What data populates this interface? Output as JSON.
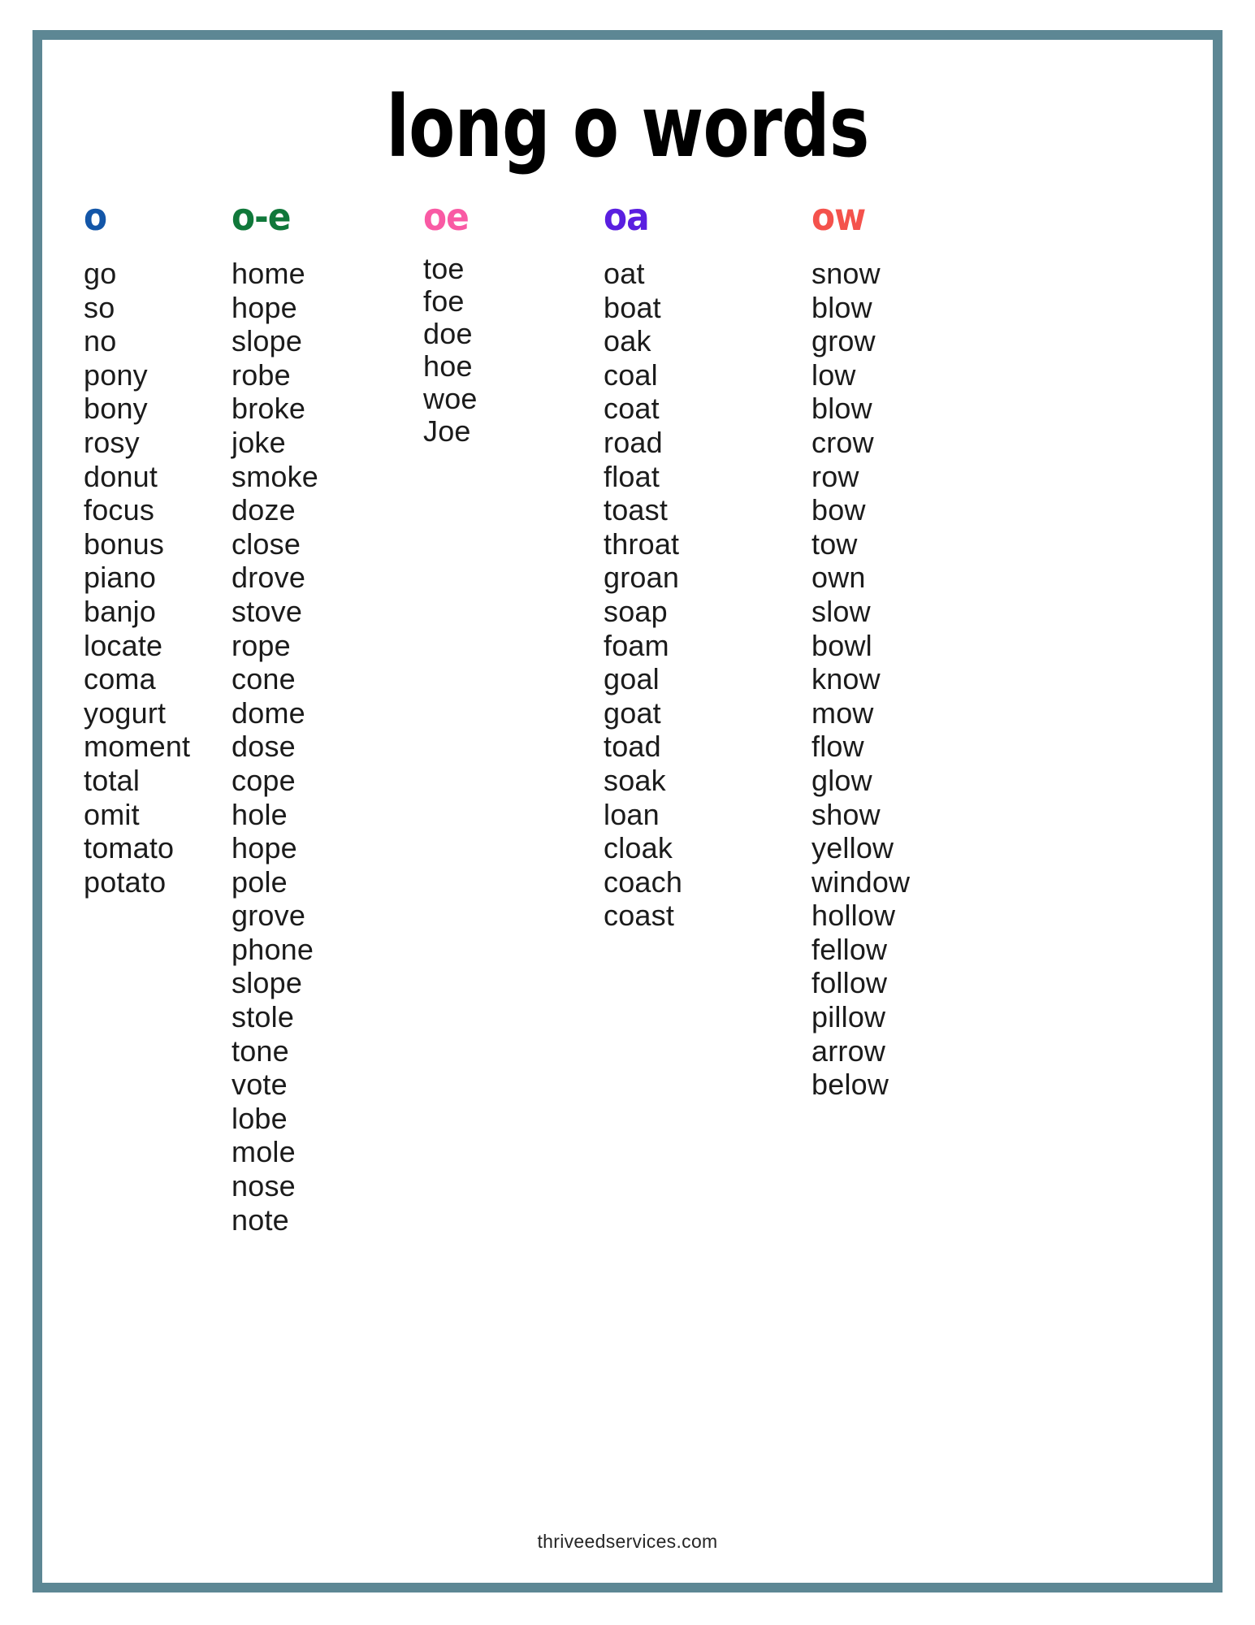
{
  "page": {
    "title": "long o words",
    "footer": "thriveedservices.com",
    "border_color": "#5d8794",
    "background_color": "#ffffff",
    "text_color": "#1b1b1b"
  },
  "columns": [
    {
      "header": "o",
      "header_color": "#1356a8",
      "words": [
        "go",
        "so",
        "no",
        "pony",
        "bony",
        "rosy",
        "donut",
        "focus",
        "bonus",
        "piano",
        "banjo",
        "locate",
        "coma",
        "yogurt",
        "moment",
        "total",
        "omit",
        "tomato",
        "potato"
      ]
    },
    {
      "header": "o-e",
      "header_color": "#10783a",
      "words": [
        "home",
        "hope",
        "slope",
        "robe",
        "broke",
        "joke",
        "smoke",
        "doze",
        "close",
        "drove",
        "stove",
        "rope",
        "cone",
        "dome",
        "dose",
        "cope",
        "hole",
        "hope",
        "pole",
        "grove",
        "phone",
        "slope",
        "stole",
        "tone",
        "vote",
        "lobe",
        "mole",
        "nose",
        "note"
      ]
    },
    {
      "header": "oe",
      "header_color": "#f95aa4",
      "words": [
        "toe",
        "foe",
        "doe",
        "hoe",
        "woe",
        "Joe"
      ]
    },
    {
      "header": "oa",
      "header_color": "#5a1fe0",
      "words": [
        "oat",
        "boat",
        "oak",
        "coal",
        "coat",
        "road",
        "float",
        "toast",
        "throat",
        "groan",
        "soap",
        "foam",
        "goal",
        "goat",
        "toad",
        "soak",
        "loan",
        "cloak",
        "coach",
        "coast"
      ]
    },
    {
      "header": "ow",
      "header_color": "#f4524c",
      "words": [
        "snow",
        "blow",
        "grow",
        "low",
        "blow",
        "crow",
        "row",
        "bow",
        "tow",
        "own",
        "slow",
        "bowl",
        "know",
        "mow",
        "flow",
        "glow",
        "show",
        "yellow",
        "window",
        "hollow",
        "fellow",
        "follow",
        "pillow",
        "arrow",
        "below"
      ]
    }
  ]
}
